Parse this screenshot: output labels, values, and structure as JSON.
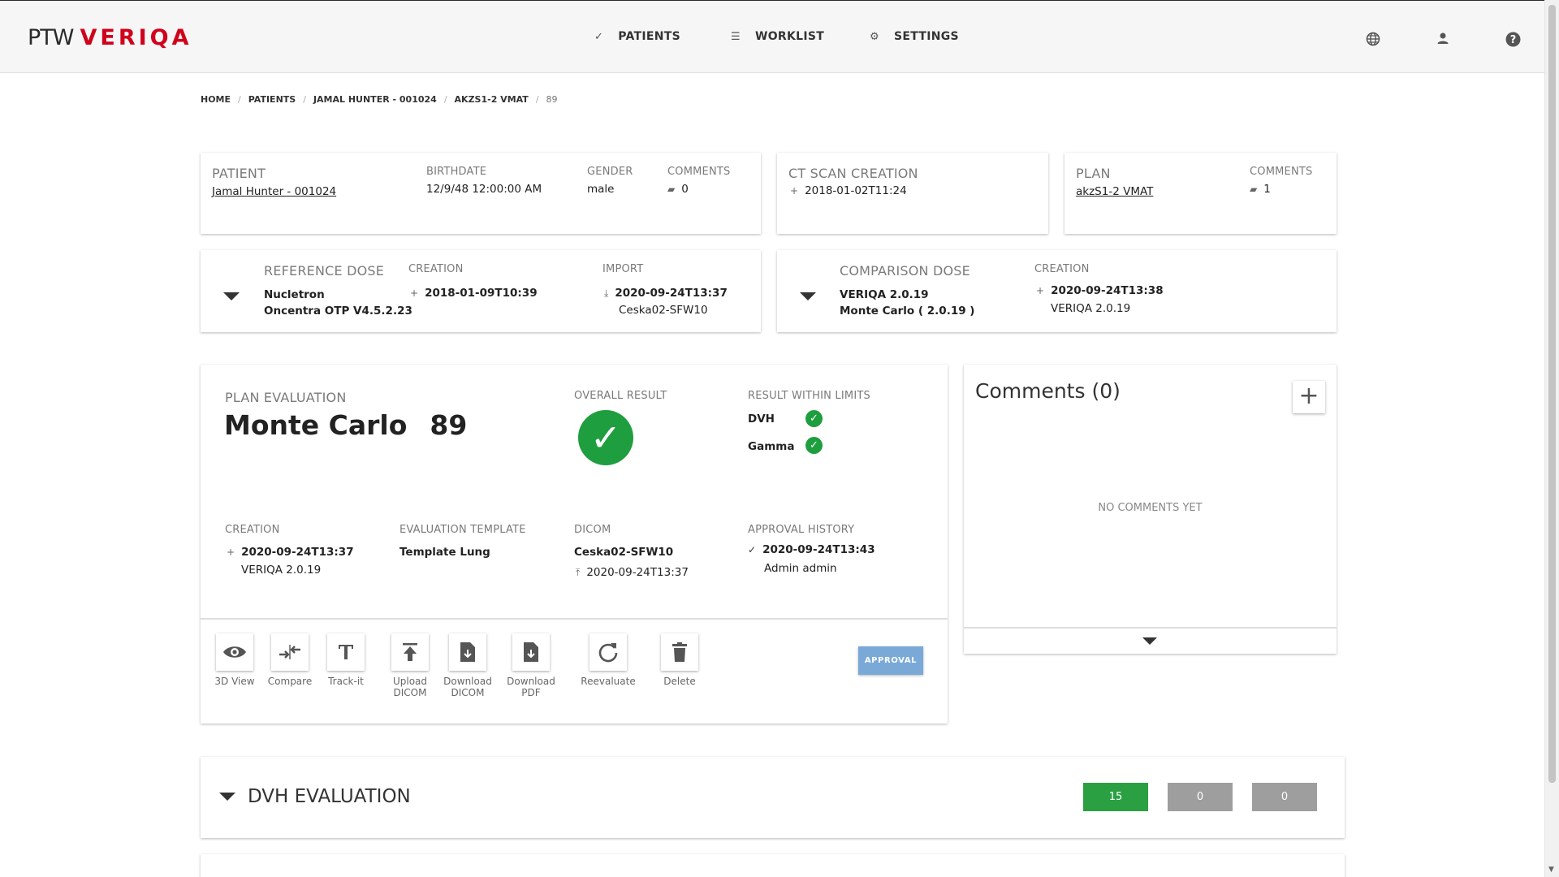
{
  "app": {
    "logo_ptw": "PTW",
    "logo_veriqa": "VERIQA"
  },
  "nav": [
    {
      "label": "PATIENTS",
      "icon": "check-icon"
    },
    {
      "label": "WORKLIST",
      "icon": "list-icon"
    },
    {
      "label": "SETTINGS",
      "icon": "gear-icon"
    }
  ],
  "breadcrumb": [
    "HOME",
    "PATIENTS",
    "JAMAL HUNTER - 001024",
    "AKZS1-2 VMAT",
    "89"
  ],
  "patient": {
    "label": "PATIENT",
    "name": "Jamal Hunter - 001024",
    "birthdate_label": "BIRTHDATE",
    "birthdate": "12/9/48 12:00:00 AM",
    "gender_label": "GENDER",
    "gender": "male",
    "comments_label": "COMMENTS",
    "comments": "0"
  },
  "ct_scan": {
    "label": "CT SCAN CREATION",
    "value": "2018-01-02T11:24"
  },
  "plan": {
    "label": "PLAN",
    "name": "akzS1-2 VMAT",
    "comments_label": "COMMENTS",
    "comments": "1"
  },
  "reference_dose": {
    "label": "REFERENCE DOSE",
    "line1": "Nucletron",
    "line2": "Oncentra OTP V4.5.2.23",
    "creation_label": "CREATION",
    "creation": "2018-01-09T10:39",
    "import_label": "IMPORT",
    "import": "2020-09-24T13:37",
    "import_source": "Ceska02-SFW10"
  },
  "comparison_dose": {
    "label": "COMPARISON DOSE",
    "line1": "VERIQA 2.0.19",
    "line2": "Monte Carlo ( 2.0.19 )",
    "creation_label": "CREATION",
    "creation": "2020-09-24T13:38",
    "creation_source": "VERIQA 2.0.19"
  },
  "evaluation": {
    "label": "PLAN EVALUATION",
    "title": "Monte Carlo",
    "number": "89",
    "overall_label": "OVERALL RESULT",
    "limits_label": "RESULT WITHIN LIMITS",
    "limits": [
      {
        "name": "DVH"
      },
      {
        "name": "Gamma"
      }
    ],
    "creation_label": "CREATION",
    "creation": "2020-09-24T13:37",
    "creation_source": "VERIQA 2.0.19",
    "template_label": "EVALUATION TEMPLATE",
    "template": "Template Lung",
    "dicom_label": "DICOM",
    "dicom": "Ceska02-SFW10",
    "dicom_date": "2020-09-24T13:37",
    "approval_label": "APPROVAL HISTORY",
    "approval_date": "2020-09-24T13:43",
    "approval_user": "Admin admin"
  },
  "actions": [
    {
      "line1": "3D View",
      "line2": "",
      "icon": "eye-icon"
    },
    {
      "line1": "Compare",
      "line2": "",
      "icon": "compare-icon"
    },
    {
      "line1": "Track-it",
      "line2": "",
      "icon": "track-it-icon"
    },
    {
      "line1": "Upload",
      "line2": "DICOM",
      "icon": "upload-icon"
    },
    {
      "line1": "Download",
      "line2": "DICOM",
      "icon": "download-file-icon"
    },
    {
      "line1": "Download",
      "line2": "PDF",
      "icon": "download-pdf-icon"
    },
    {
      "line1": "Reevaluate",
      "line2": "",
      "icon": "refresh-icon"
    },
    {
      "line1": "Delete",
      "line2": "",
      "icon": "trash-icon"
    }
  ],
  "approval_button": "APPROVAL",
  "comments_panel": {
    "title": "Comments (0)",
    "empty": "NO COMMENTS YET"
  },
  "dvh": {
    "title": "DVH EVALUATION",
    "counts": [
      "15",
      "0",
      "0"
    ]
  },
  "colors": {
    "accent_red": "#d0021b",
    "success_green": "#1e9e3e",
    "approval_blue": "#7aa9d8",
    "neutral_grey": "#9e9e9e"
  }
}
